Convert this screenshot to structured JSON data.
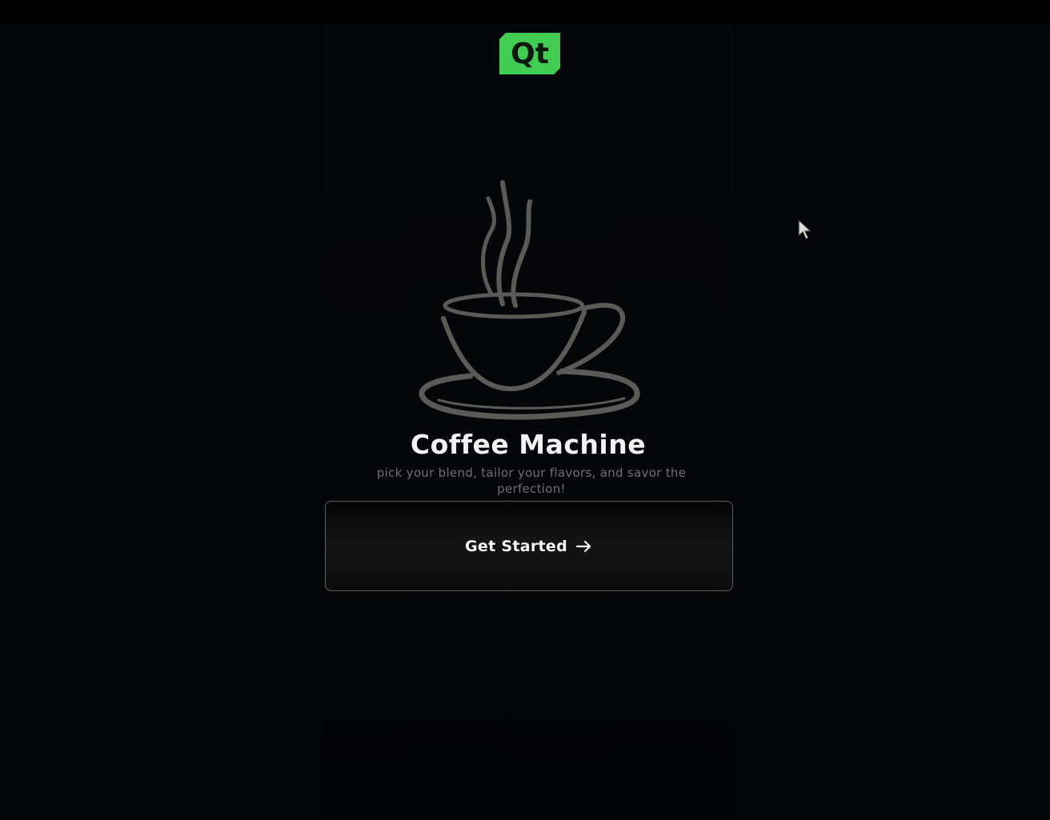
{
  "logo": {
    "text": "Qt",
    "color": "#41cd52"
  },
  "app": {
    "title": "Coffee Machine",
    "subtitle": "pick your blend, tailor your flavors, and savor the perfection!"
  },
  "start_button": {
    "label": "Get Started",
    "icon": "arrow-right-icon"
  },
  "illustration": {
    "icon": "coffee-cup-icon",
    "stroke_color": "#5a5a56"
  },
  "colors": {
    "background": "#040506",
    "title": "#f2f2f2",
    "subtitle": "#6f6f6f",
    "button_border": "#5f5f5f"
  }
}
